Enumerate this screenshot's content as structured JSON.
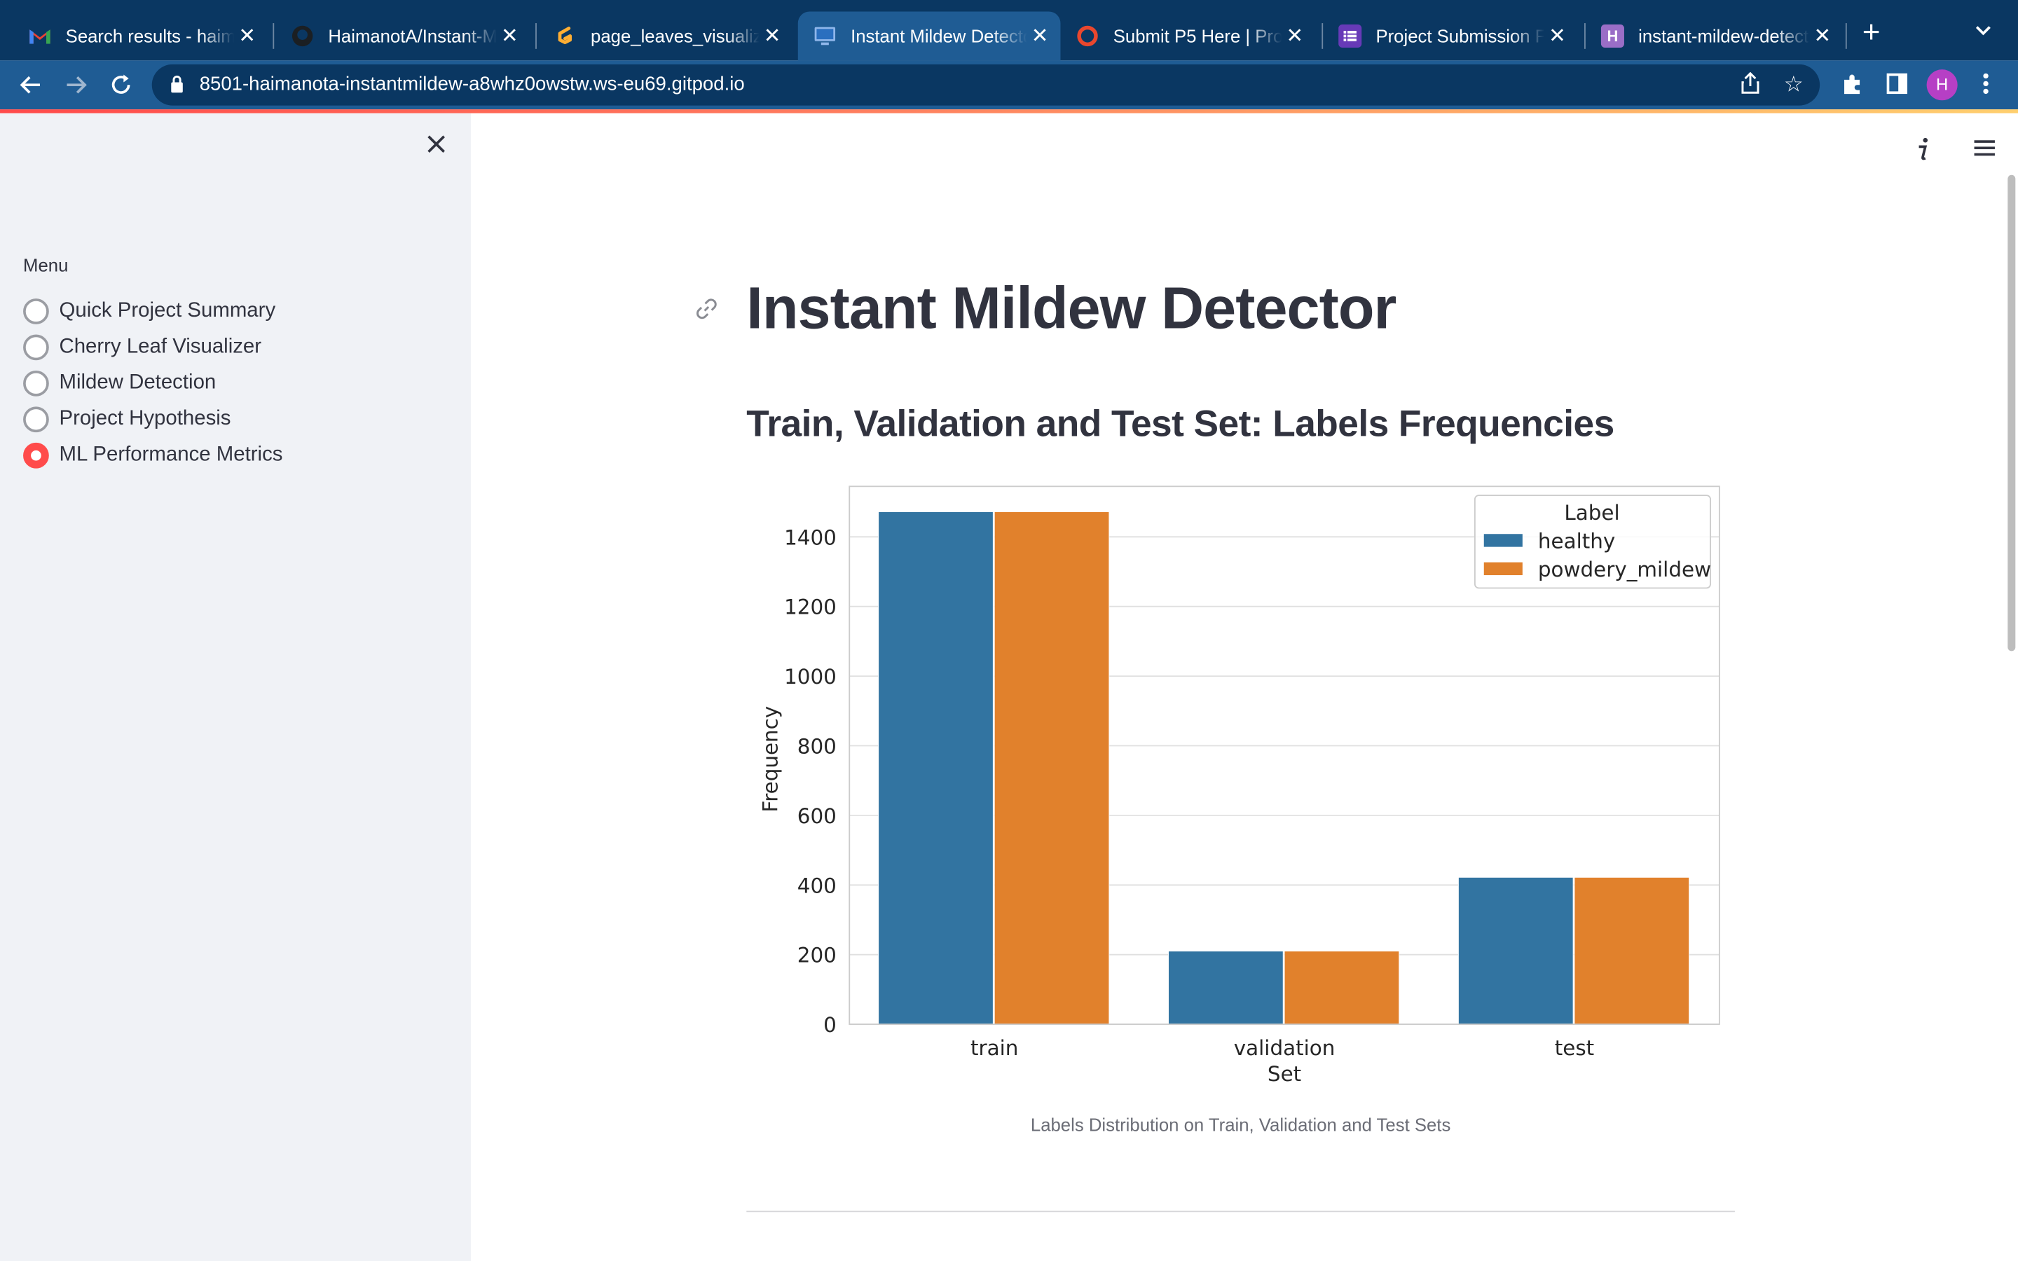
{
  "browser": {
    "tabs": [
      {
        "title": "Search results - haimanota",
        "favicon": "gmail-icon",
        "active": false
      },
      {
        "title": "HaimanotA/Instant-Mildew-Detector",
        "favicon": "github-icon",
        "active": false
      },
      {
        "title": "page_leaves_visualizer.py",
        "favicon": "gitpod-icon",
        "active": false
      },
      {
        "title": "Instant Mildew Detector",
        "favicon": "monitor-icon",
        "active": true
      },
      {
        "title": "Submit P5 Here | Project",
        "favicon": "circle-icon",
        "active": false
      },
      {
        "title": "Project Submission Form",
        "favicon": "form-icon",
        "active": false
      },
      {
        "title": "instant-mildew-detector",
        "favicon": "heroku-icon",
        "active": false
      }
    ],
    "url": "8501-haimanota-instantmildew-a8whz0owstw.ws-eu69.gitpod.io",
    "profile_initial": "H"
  },
  "sidebar": {
    "menu_label": "Menu",
    "items": [
      {
        "label": "Quick Project Summary",
        "selected": false
      },
      {
        "label": "Cherry Leaf Visualizer",
        "selected": false
      },
      {
        "label": "Mildew Detection",
        "selected": false
      },
      {
        "label": "Project Hypothesis",
        "selected": false
      },
      {
        "label": "ML Performance Metrics",
        "selected": true
      }
    ]
  },
  "main": {
    "title": "Instant Mildew Detector",
    "subtitle": "Train, Validation and Test Set: Labels Frequencies",
    "caption": "Labels Distribution on Train, Validation and Test Sets"
  },
  "colors": {
    "accent": "#ff4b4b",
    "healthy": "#3274a1",
    "powdery_mildew": "#e1812c"
  },
  "chart_data": {
    "type": "bar",
    "categories": [
      "train",
      "validation",
      "test"
    ],
    "series": [
      {
        "name": "healthy",
        "values": [
          1472,
          210,
          422
        ]
      },
      {
        "name": "powdery_mildew",
        "values": [
          1472,
          210,
          422
        ]
      }
    ],
    "xlabel": "Set",
    "ylabel": "Frequency",
    "legend_title": "Label",
    "legend_position": "top-right",
    "ylim": [
      0,
      1545
    ],
    "yticks": [
      0,
      200,
      400,
      600,
      800,
      1000,
      1200,
      1400
    ],
    "grid": true
  }
}
